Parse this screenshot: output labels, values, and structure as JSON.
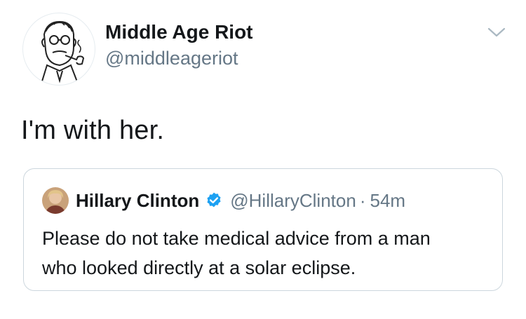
{
  "tweet": {
    "author": {
      "display_name": "Middle Age Riot",
      "handle": "@middleageriot",
      "avatar": "avatar-illustration-icon"
    },
    "menu_icon": "chevron-down-icon",
    "text": "I'm with her."
  },
  "quoted_tweet": {
    "author": {
      "display_name": "Hillary Clinton",
      "verified_icon": "verified-badge-icon",
      "handle": "@HillaryClinton",
      "separator": "·",
      "time": "54m",
      "avatar": "avatar-photo-icon"
    },
    "text_lines": [
      "Please do not take medical advice from a man",
      "who looked directly at a solar eclipse."
    ]
  },
  "colors": {
    "primary_text": "#14171a",
    "secondary_text": "#657786",
    "border": "#ccd6dd",
    "verified_blue": "#1da1f2"
  }
}
